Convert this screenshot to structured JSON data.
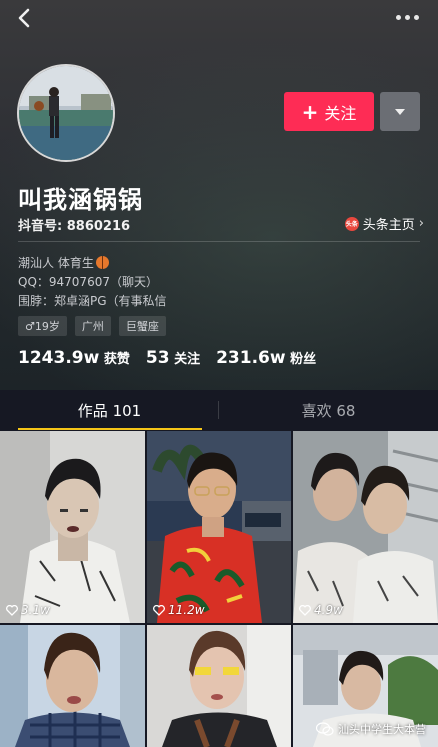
{
  "profile": {
    "name": "叫我涵锅锅",
    "douyin_id": "抖音号: 8860216",
    "toutiao_link": "头条主页",
    "toutiao_icon_text": "头条",
    "follow_label": "关注",
    "bio_line1": "潮汕人 体育生",
    "bio_line2": "QQ：94707607（聊天）",
    "bio_line3": "围脖：郑卓涵PG（有事私信",
    "tags": [
      "♂19岁",
      "广州",
      "巨蟹座"
    ],
    "stats": {
      "likes_num": "1243.9w",
      "likes_label": "获赞",
      "following_num": "53",
      "following_label": "关注",
      "followers_num": "231.6w",
      "followers_label": "粉丝"
    }
  },
  "tabs": {
    "works": "作品 101",
    "likes": "喜欢 68"
  },
  "videos": [
    {
      "likes": "3.1w"
    },
    {
      "likes": "11.2w"
    },
    {
      "likes": "4.9w"
    }
  ],
  "watermark": "汕头中学生大本营",
  "colors": {
    "accent": "#fe2c55",
    "tab_underline": "#f5c518",
    "background": "#161823"
  }
}
